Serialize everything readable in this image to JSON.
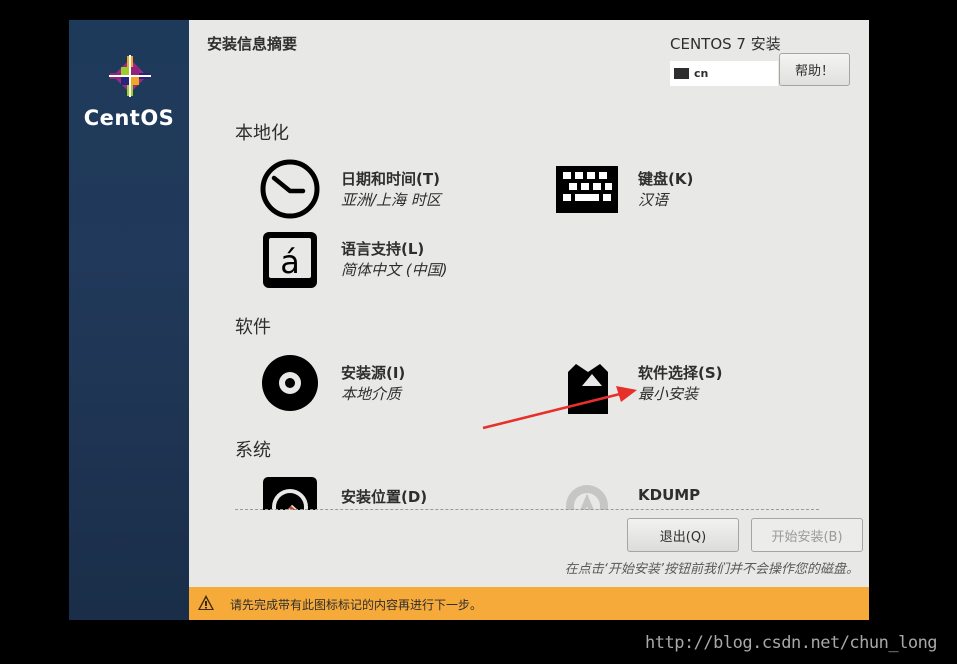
{
  "sidebar": {
    "logo_text": "CentOS"
  },
  "header": {
    "hub_title": "安装信息摘要",
    "product_title": "CENTOS 7 安装",
    "keyboard_layout": "cn",
    "help_label": "帮助！"
  },
  "sections": {
    "localization": {
      "title": "本地化",
      "datetime": {
        "name": "日期和时间(T)",
        "status": "亚洲/上海 时区",
        "icon": "clock-icon"
      },
      "keyboard": {
        "name": "键盘(K)",
        "status": "汉语",
        "icon": "keyboard-icon"
      },
      "language": {
        "name": "语言支持(L)",
        "status": "简体中文 (中国)",
        "icon": "language-icon"
      }
    },
    "software": {
      "title": "软件",
      "source": {
        "name": "安装源(I)",
        "status": "本地介质",
        "icon": "disc-icon"
      },
      "selection": {
        "name": "软件选择(S)",
        "status": "最小安装",
        "icon": "package-icon"
      }
    },
    "system": {
      "title": "系统",
      "destination": {
        "name": "安装位置(D)",
        "icon": "harddisk-icon"
      },
      "kdump": {
        "name": "KDUMP",
        "icon": "kdump-icon"
      }
    }
  },
  "footer": {
    "quit_label": "退出(Q)",
    "begin_label": "开始安装(B)",
    "notice": "在点击‘开始安装’按钮前我们并不会操作您的磁盘。",
    "warning": "请先完成带有此图标标记的内容再进行下一步。"
  },
  "watermark": "http://blog.csdn.net/chun_long",
  "colors": {
    "sidebar": "#1e3a5a",
    "background": "#e8e8e7",
    "warning_bar": "#f6aa3a",
    "arrow": "#e8302a"
  }
}
